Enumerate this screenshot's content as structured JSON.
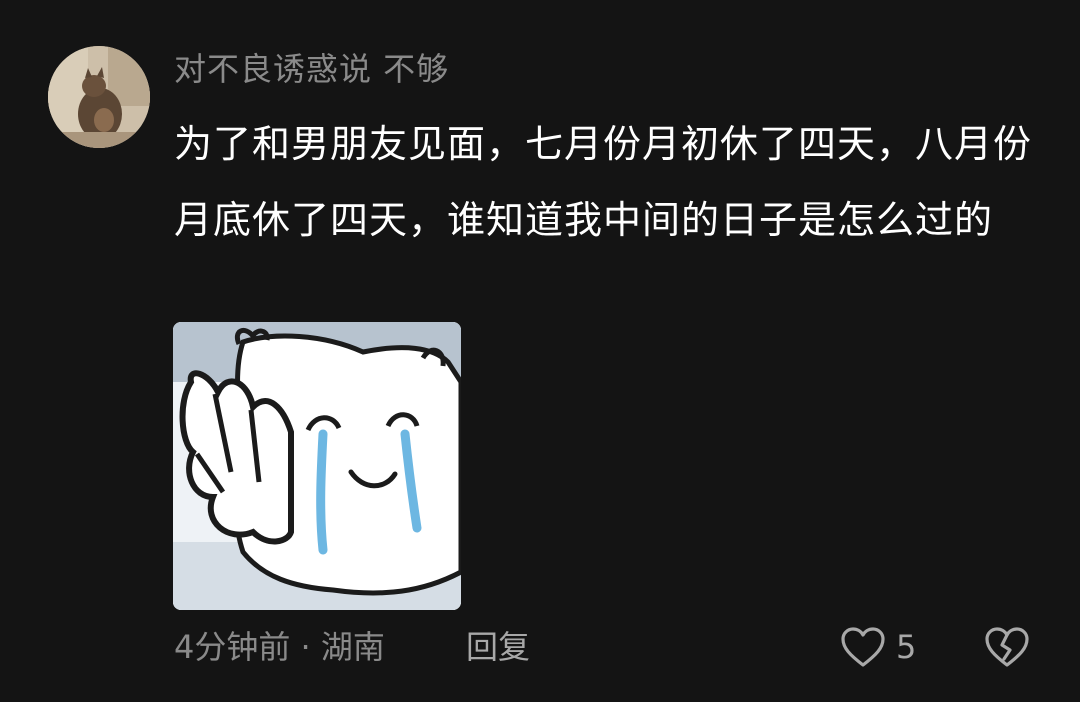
{
  "comment": {
    "username": "对不良诱惑说 不够",
    "text": "为了和男朋友见面，七月份月初休了四天，八月份月底休了四天，谁知道我中间的日子是怎么过的",
    "time": "4分钟前",
    "separator": " · ",
    "location": "湖南",
    "reply_label": "回复",
    "like_count": "5"
  },
  "icons": {
    "avatar": "avatar-photo-cat",
    "sticker": "crying-cartoon-sticker",
    "like": "heart-outline-icon",
    "dislike": "broken-heart-icon"
  },
  "colors": {
    "background": "#141414",
    "username": "#8a8a8a",
    "text": "#ffffff",
    "meta": "#8a8a8a",
    "sticker_tears": "#6db7e2"
  }
}
